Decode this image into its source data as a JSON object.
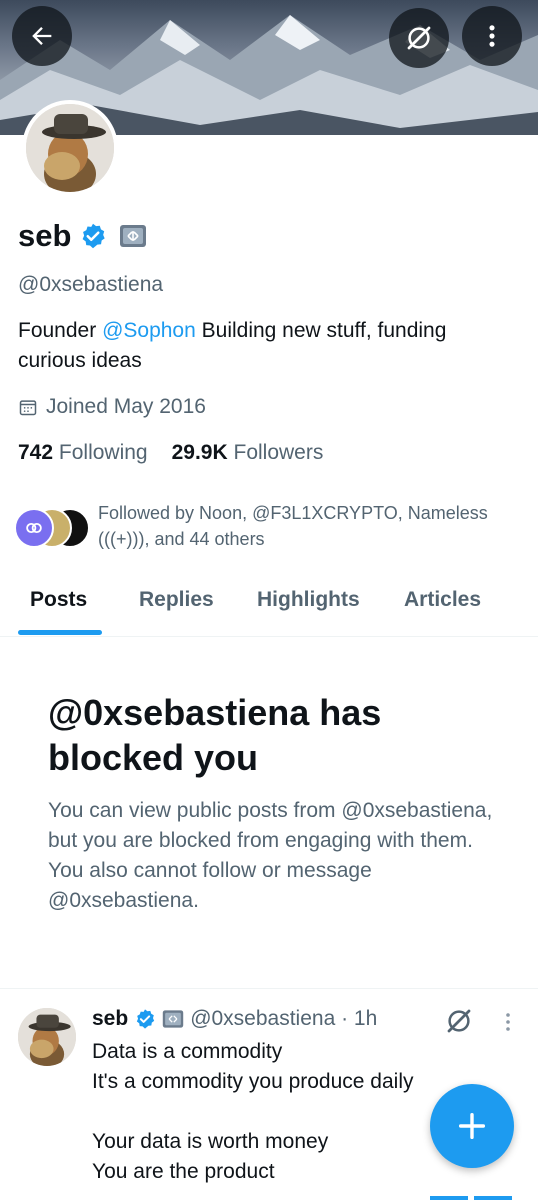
{
  "profile": {
    "name": "seb",
    "handle": "@0xsebastiena",
    "bio_prefix": "Founder ",
    "bio_mention": "@Sophon",
    "bio_suffix": "  Building new stuff, funding curious ideas",
    "joined": "Joined May 2016",
    "following_count": "742",
    "following_label": "Following",
    "followers_count": "29.9K",
    "followers_label": "Followers",
    "followed_by": "Followed by Noon, @F3L1XCRYPTO, Nameless (((+))), and 44 others"
  },
  "tabs": [
    {
      "label": "Posts",
      "active": true
    },
    {
      "label": "Replies",
      "active": false
    },
    {
      "label": "Highlights",
      "active": false
    },
    {
      "label": "Articles",
      "active": false
    }
  ],
  "blocked": {
    "title": "@0xsebastiena has blocked you",
    "message": "You can view public posts from @0xsebastiena, but you are blocked from engaging with them. You also cannot follow or message @0xsebastiena."
  },
  "post": {
    "name": "seb",
    "handle_time": "@0xsebastiena · 1h",
    "lines": [
      "Data is a commodity",
      "It's a commodity you produce daily",
      "",
      "Your data is worth money",
      "You are the product"
    ]
  },
  "icons": {
    "back": "back-arrow-icon",
    "grok": "grok-icon",
    "more": "more-vertical-icon",
    "verified": "verified-badge-icon",
    "affiliate": "affiliate-badge-icon",
    "calendar": "calendar-icon",
    "compose": "plus-icon"
  },
  "colors": {
    "accent": "#1d9bf0",
    "text": "#0f1419",
    "secondary": "#536471"
  }
}
